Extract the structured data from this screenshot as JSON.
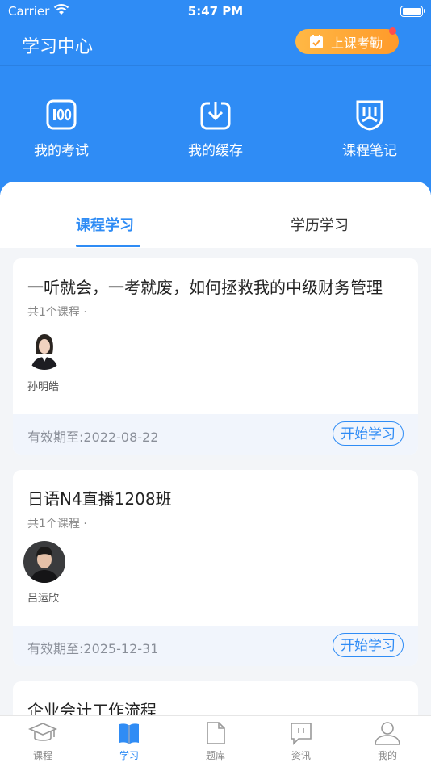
{
  "status_bar": {
    "carrier": "Carrier",
    "time": "5:47 PM"
  },
  "header": {
    "title": "学习中心",
    "attendance_label": "上课考勤"
  },
  "quick_actions": [
    {
      "label": "我的考试",
      "icon": "score-100-icon"
    },
    {
      "label": "我的缓存",
      "icon": "download-icon"
    },
    {
      "label": "课程笔记",
      "icon": "notes-badge-icon"
    }
  ],
  "tabs": [
    {
      "label": "课程学习",
      "active": true
    },
    {
      "label": "学历学习",
      "active": false
    }
  ],
  "courses": [
    {
      "title": "一听就会，一考就废，如何拯救我的中级财务管理",
      "subtitle": "共1个课程 ·",
      "teacher": "孙明皓",
      "expire": "有效期至:2022-08-22",
      "button": "开始学习"
    },
    {
      "title": "日语N4直播1208班",
      "subtitle": "共1个课程 ·",
      "teacher": "吕运欣",
      "expire": "有效期至:2025-12-31",
      "button": "开始学习"
    },
    {
      "title": "企业会计工作流程"
    }
  ],
  "tabbar": [
    {
      "label": "课程",
      "icon": "graduation-cap-icon",
      "active": false
    },
    {
      "label": "学习",
      "icon": "book-icon",
      "active": true
    },
    {
      "label": "题库",
      "icon": "document-icon",
      "active": false
    },
    {
      "label": "资讯",
      "icon": "message-icon",
      "active": false
    },
    {
      "label": "我的",
      "icon": "user-icon",
      "active": false
    }
  ],
  "colors": {
    "primary": "#2f8cf5",
    "attendance_gradient_start": "#ffb845",
    "attendance_gradient_end": "#ff9a2a",
    "badge": "#ff4d4f"
  }
}
